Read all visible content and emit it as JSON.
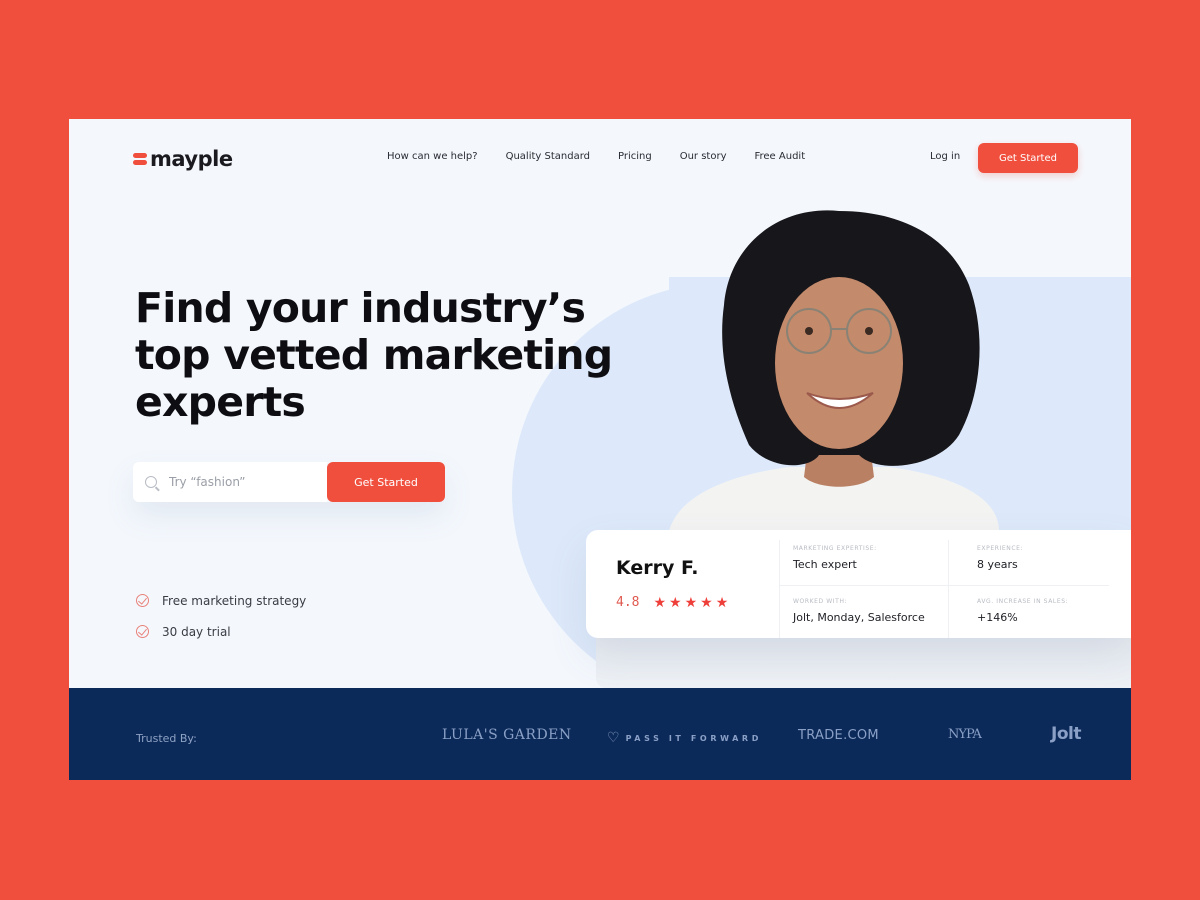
{
  "brand": {
    "name": "mayple",
    "accent_color": "#f04f3d",
    "navy_color": "#0c2a59"
  },
  "nav": {
    "items": [
      "How can we help?",
      "Quality Standard",
      "Pricing",
      "Our story",
      "Free Audit"
    ],
    "login_label": "Log in",
    "cta_label": "Get Started"
  },
  "hero": {
    "title": "Find your industry’s top vetted marketing experts",
    "search": {
      "placeholder": "Try “fashion”",
      "value": "",
      "button_label": "Get Started"
    },
    "perks": [
      "Free marketing strategy",
      "30 day trial"
    ]
  },
  "expert_card": {
    "name": "Kerry F.",
    "rating": "4.8",
    "rating_value": 4.8,
    "rating_max": 5,
    "fields": [
      {
        "label": "Marketing expertise:",
        "value": "Tech expert"
      },
      {
        "label": "Experience:",
        "value": "8 years"
      },
      {
        "label": "Worked with:",
        "value": "Jolt, Monday, Salesforce"
      },
      {
        "label": "Avg. increase in sales:",
        "value": "+146%"
      }
    ]
  },
  "footer": {
    "trusted_label": "Trusted By:",
    "logos": [
      "LULA'S GARDEN",
      "PASS IT FORWARD",
      "TRADE.COM",
      "NYPA",
      "Jolt"
    ]
  }
}
